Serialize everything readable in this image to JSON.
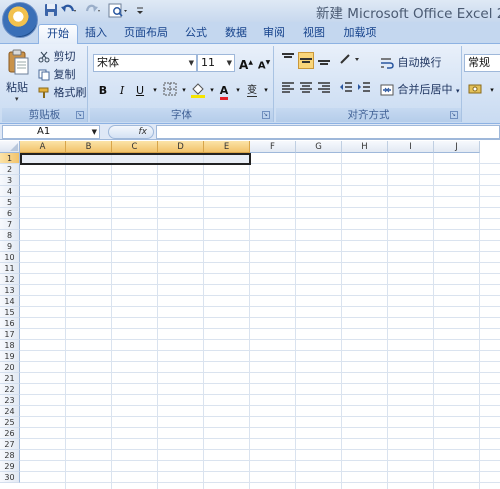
{
  "title": "新建 Microsoft Office Excel 2",
  "tabs": [
    {
      "label": "开始",
      "active": true
    },
    {
      "label": "插入"
    },
    {
      "label": "页面布局"
    },
    {
      "label": "公式"
    },
    {
      "label": "数据"
    },
    {
      "label": "审阅"
    },
    {
      "label": "视图"
    },
    {
      "label": "加载项"
    }
  ],
  "clipboard": {
    "paste": "粘贴",
    "cut": "剪切",
    "copy": "复制",
    "format_painter": "格式刷",
    "group": "剪贴板"
  },
  "font": {
    "name": "宋体",
    "size": "11",
    "bold": "B",
    "italic": "I",
    "underline": "U",
    "grow": "A",
    "shrink": "A",
    "font_color": "A",
    "phonetic": "变",
    "group": "字体"
  },
  "alignment": {
    "wrap": "自动换行",
    "merge": "合并后居中",
    "group": "对齐方式"
  },
  "number": {
    "format": "常规"
  },
  "formula_bar": {
    "name_box": "A1",
    "fx": "fx",
    "content": ""
  },
  "columns": [
    "A",
    "B",
    "C",
    "D",
    "E",
    "F",
    "G",
    "H",
    "I",
    "J"
  ],
  "rows": [
    "1",
    "2",
    "3",
    "4",
    "5",
    "6",
    "7",
    "8",
    "9",
    "10",
    "11",
    "12",
    "13",
    "14",
    "15",
    "16",
    "17",
    "18",
    "19",
    "20",
    "21",
    "22",
    "23",
    "24",
    "25",
    "26",
    "27",
    "28",
    "29",
    "30"
  ],
  "selection": {
    "columns": [
      "A",
      "B",
      "C",
      "D",
      "E"
    ],
    "row": "1"
  },
  "colors": {
    "accent": "#15428b",
    "selected_header": "#f2c36b",
    "ribbon": "#d5e3f5"
  }
}
